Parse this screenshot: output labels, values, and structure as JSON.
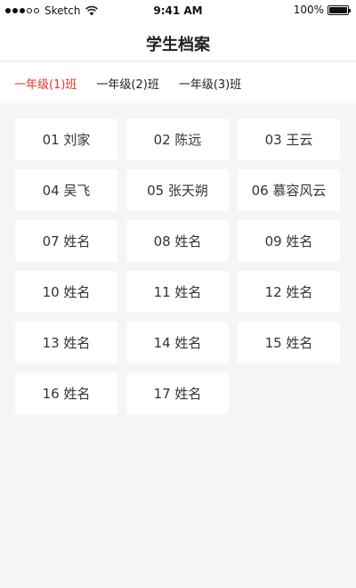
{
  "status_bar": {
    "carrier": "Sketch",
    "time": "9:41 AM",
    "battery_text": "100%",
    "battery_level": 1.0,
    "signal_bars_filled": 3,
    "signal_bars_total": 5,
    "icons": [
      "signal-dots-icon",
      "wifi-icon",
      "battery-icon"
    ]
  },
  "nav": {
    "title": "学生档案"
  },
  "class_tabs": [
    {
      "label": "一年级(1)班",
      "active": true
    },
    {
      "label": "一年级(2)班",
      "active": false
    },
    {
      "label": "一年级(3)班",
      "active": false
    }
  ],
  "colors": {
    "accent": "#e8322c",
    "background": "#f5f5f5",
    "card": "#ffffff",
    "text": "#333333"
  },
  "students": [
    {
      "label": "01 刘家"
    },
    {
      "label": "02 陈远"
    },
    {
      "label": "03 王云"
    },
    {
      "label": "04 吴飞"
    },
    {
      "label": "05 张天朔"
    },
    {
      "label": "06 慕容风云"
    },
    {
      "label": "07 姓名"
    },
    {
      "label": "08 姓名"
    },
    {
      "label": "09 姓名"
    },
    {
      "label": "10 姓名"
    },
    {
      "label": "11 姓名"
    },
    {
      "label": "12 姓名"
    },
    {
      "label": "13 姓名"
    },
    {
      "label": "14 姓名"
    },
    {
      "label": "15 姓名"
    },
    {
      "label": "16 姓名"
    },
    {
      "label": "17 姓名"
    }
  ]
}
